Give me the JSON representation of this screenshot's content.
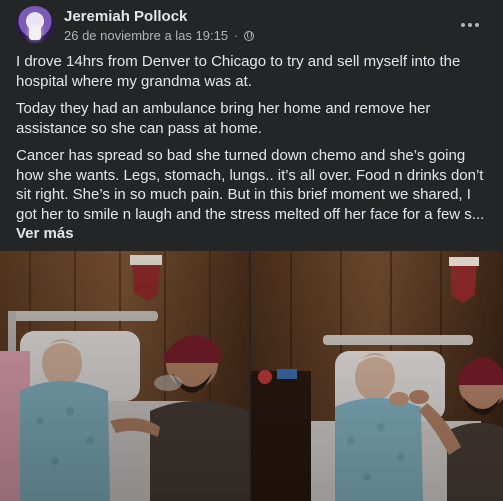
{
  "post": {
    "author": "Jeremiah Pollock",
    "timestamp": "26 de noviembre a las 19:15",
    "separator": "·",
    "audience_icon": "globe-icon",
    "more_icon": "more-options-icon",
    "paragraphs": [
      "I drove 14hrs from Denver to Chicago to try and sell myself into the hospital where my grandma was at.",
      "Today they had an ambulance bring her home and remove her assistance so she can pass at home.",
      "Cancer has spread so bad she turned down chemo and she’s going how she wants. Legs, stomach, lungs.. it’s all over. Food n drinks don’t sit right. She’s in so much pain. But in this brief moment we shared, I got her to smile n laugh and the stress melted off her face for a few s..."
    ],
    "see_more": "Ver más",
    "photo_count": 2
  },
  "colors": {
    "background": "#242526",
    "primary_text": "#e4e6eb",
    "secondary_text": "#b0b3b8"
  }
}
